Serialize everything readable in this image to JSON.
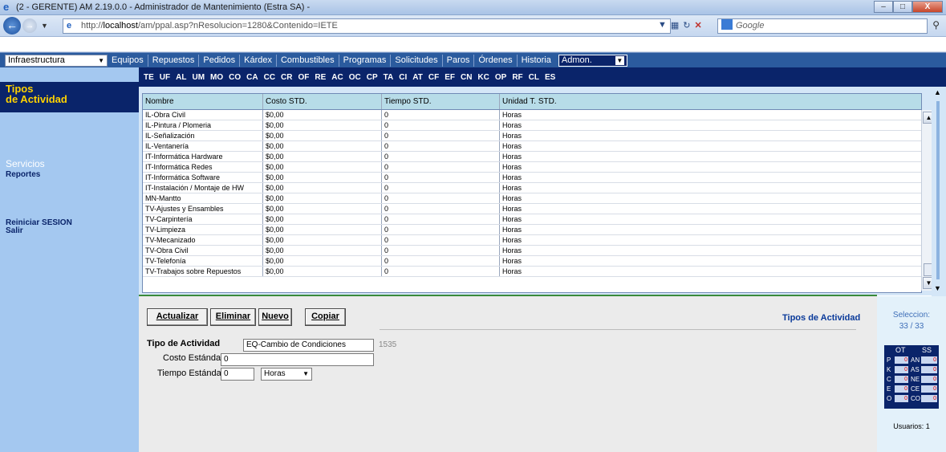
{
  "browser": {
    "window_title": "(2 - GERENTE) AM 2.19.0.0 - Administrador de Mantenimiento (Estra SA) -",
    "window_buttons": {
      "minimize": "–",
      "maximize": "□",
      "close": "X"
    },
    "url_prefix": "http://",
    "url_host": "localhost",
    "url_path": "/am/ppal.asp?nResolucion=1280&Contenido=IETE",
    "search_placeholder": "Google"
  },
  "menubar": {
    "site_select": "Infraestructura",
    "items": [
      "Equipos",
      "Repuestos",
      "Pedidos",
      "Kárdex",
      "Combustibles",
      "Programas",
      "Solicitudes",
      "Paros",
      "Órdenes",
      "Historia"
    ],
    "admin_select": "Admon."
  },
  "sidebar": {
    "section_title_1": "Tipos",
    "section_title_2": "de Actividad",
    "servicios": "Servicios",
    "reportes": "Reportes",
    "reiniciar": "Reiniciar SESION",
    "salir": "Salir"
  },
  "tabs": [
    "TE",
    "UF",
    "AL",
    "UM",
    "MO",
    "CO",
    "CA",
    "CC",
    "CR",
    "OF",
    "RE",
    "AC",
    "OC",
    "CP",
    "TA",
    "CI",
    "AT",
    "CF",
    "EF",
    "CN",
    "KC",
    "OP",
    "RF",
    "CL",
    "ES"
  ],
  "table": {
    "headers": [
      "Nombre",
      "Costo STD.",
      "Tiempo STD.",
      "Unidad T. STD."
    ],
    "rows": [
      [
        "IL-Obra Civil",
        "$0,00",
        "0",
        "Horas"
      ],
      [
        "IL-Pintura / Plomeria",
        "$0,00",
        "0",
        "Horas"
      ],
      [
        "IL-Señalización",
        "$0,00",
        "0",
        "Horas"
      ],
      [
        "IL-Ventanería",
        "$0,00",
        "0",
        "Horas"
      ],
      [
        "IT-Informática Hardware",
        "$0,00",
        "0",
        "Horas"
      ],
      [
        "IT-Informática Redes",
        "$0,00",
        "0",
        "Horas"
      ],
      [
        "IT-Informática Software",
        "$0,00",
        "0",
        "Horas"
      ],
      [
        "IT-Instalación / Montaje de HW",
        "$0,00",
        "0",
        "Horas"
      ],
      [
        "MN-Mantto",
        "$0,00",
        "0",
        "Horas"
      ],
      [
        "TV-Ajustes y Ensambles",
        "$0,00",
        "0",
        "Horas"
      ],
      [
        "TV-Carpintería",
        "$0,00",
        "0",
        "Horas"
      ],
      [
        "TV-Limpieza",
        "$0,00",
        "0",
        "Horas"
      ],
      [
        "TV-Mecanizado",
        "$0,00",
        "0",
        "Horas"
      ],
      [
        "TV-Obra Civil",
        "$0,00",
        "0",
        "Horas"
      ],
      [
        "TV-Telefonía",
        "$0,00",
        "0",
        "Horas"
      ],
      [
        "TV-Trabajos sobre Repuestos",
        "$0,00",
        "0",
        "Horas"
      ]
    ]
  },
  "form": {
    "buttons": {
      "actualizar": "Actualizar",
      "eliminar": "Eliminar",
      "nuevo": "Nuevo",
      "copiar": "Copiar"
    },
    "title": "Tipos de Actividad",
    "tipo_label": "Tipo de Actividad",
    "tipo_value": "EQ-Cambio de Condiciones",
    "record_id": "1535",
    "costo_label": "Costo Estándar",
    "costo_value": "0",
    "tiempo_label": "Tiempo Estándar",
    "tiempo_value": "0",
    "unidad_value": "Horas"
  },
  "rightpanel": {
    "seleccion_label": "Seleccion:",
    "seleccion_value": "33 / 33",
    "ot_header": "OT",
    "ss_header": "SS",
    "ot_rows": [
      [
        "P",
        "0"
      ],
      [
        "K",
        "0"
      ],
      [
        "C",
        "0"
      ],
      [
        "E",
        "0"
      ],
      [
        "O",
        "0"
      ]
    ],
    "ss_rows": [
      [
        "AN",
        "0"
      ],
      [
        "AS",
        "0"
      ],
      [
        "NE",
        "0"
      ],
      [
        "CE",
        "0"
      ],
      [
        "CO",
        "0"
      ]
    ],
    "usuarios": "Usuarios: 1"
  }
}
